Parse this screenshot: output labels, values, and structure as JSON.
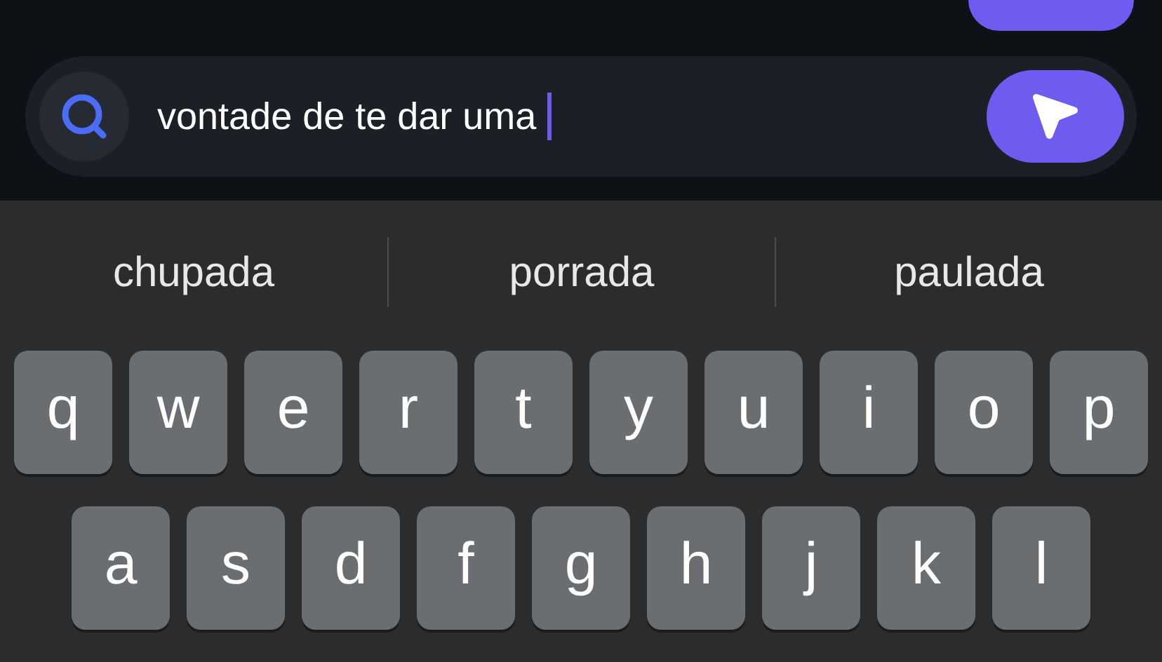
{
  "input": {
    "value": "vontade de te dar uma"
  },
  "suggestions": [
    "chupada",
    "porrada",
    "paulada"
  ],
  "key_rows": [
    [
      "q",
      "w",
      "e",
      "r",
      "t",
      "y",
      "u",
      "i",
      "o",
      "p"
    ],
    [
      "a",
      "s",
      "d",
      "f",
      "g",
      "h",
      "j",
      "k",
      "l"
    ]
  ]
}
